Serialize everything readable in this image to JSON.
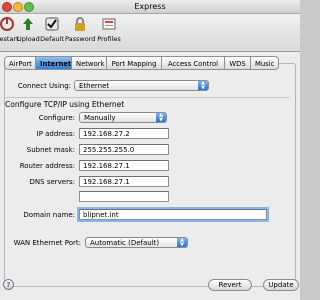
{
  "window": {
    "title": "Express"
  },
  "toolbar": {
    "items": [
      {
        "label": "Restart",
        "icon": "restart-icon"
      },
      {
        "label": "Upload",
        "icon": "upload-icon"
      },
      {
        "label": "Default",
        "icon": "default-icon"
      },
      {
        "label": "Password",
        "icon": "password-icon"
      },
      {
        "label": "Profiles",
        "icon": "profiles-icon"
      }
    ]
  },
  "tabs": [
    "AirPort",
    "Internet",
    "Network",
    "Port Mapping",
    "Access Control",
    "WDS",
    "Music"
  ],
  "active_tab": "Internet",
  "connect_using": {
    "label": "Connect Using:",
    "value": "Ethernet"
  },
  "section_title": "Configure TCP/IP using Ethernet",
  "form": {
    "configure": {
      "label": "Configure:",
      "value": "Manually"
    },
    "ip": {
      "label": "IP address:",
      "value": "192.168.27.2"
    },
    "subnet": {
      "label": "Subnet mask:",
      "value": "255.255.255.0"
    },
    "router": {
      "label": "Router address:",
      "value": "192.168.27.1"
    },
    "dns": {
      "label": "DNS servers:",
      "value": "192.168.27.1",
      "value2": ""
    },
    "domain": {
      "label": "Domain name:",
      "value": "blipnet.int"
    }
  },
  "wan": {
    "label": "WAN Ethernet Port:",
    "value": "Automatic (Default)"
  },
  "buttons": {
    "help": "?",
    "revert": "Revert",
    "update": "Update"
  },
  "colors": {
    "accent": "#3b86d8",
    "tab_active": "#5a9de6"
  }
}
